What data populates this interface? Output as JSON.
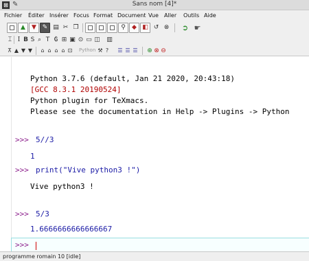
{
  "window": {
    "title": "Sans nom [4]*"
  },
  "menu": [
    "Fichier",
    "Éditer",
    "Insérer",
    "Focus",
    "Format",
    "Document",
    "Vue",
    "Aller",
    "Outils",
    "Aide"
  ],
  "toolbar3": {
    "mode_label": "Python"
  },
  "session": {
    "banner": [
      "Python 3.7.6 (default, Jan 21 2020, 20:43:18)",
      "[GCC 8.3.1 20190524]",
      "Python plugin for TeXmacs.",
      "Please see the documentation in Help -> Plugins -> Python"
    ],
    "entries": [
      {
        "prompt": ">>>",
        "input": "5//3",
        "output": "1"
      },
      {
        "prompt": ">>>",
        "input": "print(\"Vive python3 !\")",
        "output": "Vive python3 !"
      },
      {
        "prompt": ">>>",
        "input": "5/3",
        "output": "1.6666666666666667"
      }
    ],
    "current_prompt": ">>>"
  },
  "status": {
    "text": "programme romain 10 [idle]"
  },
  "icons": {
    "toolbar1": [
      "new-document-icon",
      "open-icon",
      "save-icon",
      "edit-icon",
      "print-icon",
      "cut-icon",
      "copy-icon",
      "paste-icon",
      "square-icon",
      "square-icon",
      "square-icon",
      "zoom-icon",
      "bookmark-icon",
      "image-icon",
      "undo-icon",
      "redo-icon",
      "back-icon",
      "forward-icon"
    ],
    "toolbar2": [
      "cursor-icon",
      "bold-icon",
      "sans-icon",
      "fill-icon",
      "text-icon",
      "tex-icon",
      "table-icon",
      "image-icon",
      "link-icon",
      "toggle-icon",
      "graphics-icon",
      "book-icon"
    ],
    "toolbar3": [
      "align-icon",
      "up-icon",
      "down-icon",
      "lock-icon",
      "lock-icon",
      "lock-icon",
      "lock-icon",
      "eval-icon",
      "wrench-icon",
      "help-icon",
      "list-icon",
      "list-icon",
      "list-icon",
      "green-circle-icon",
      "red-circle-icon",
      "red-circle-icon"
    ]
  }
}
